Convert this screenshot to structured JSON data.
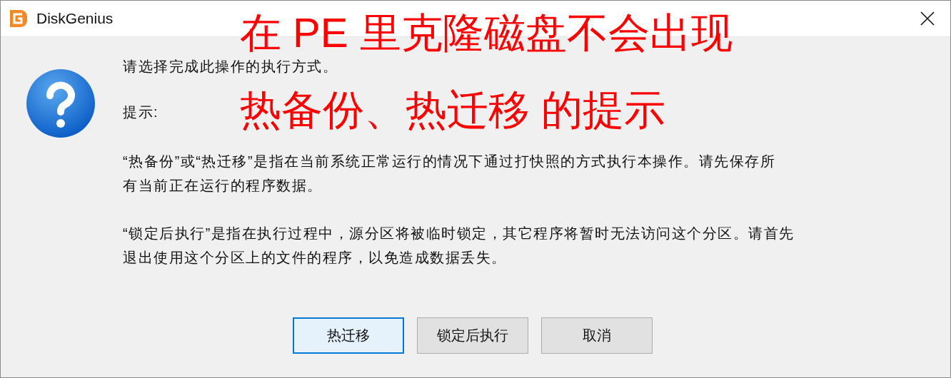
{
  "window": {
    "title": "DiskGenius"
  },
  "message": {
    "prompt": "请选择完成此操作的执行方式。",
    "hint_label": "提示:",
    "paragraphs": [
      {
        "lines": [
          "“热备份”或“热迁移”是指在当前系统正常运行的情况下通过打快照的方式执行本操作。请先保存所",
          "有当前正在运行的程序数据。"
        ]
      },
      {
        "lines": [
          "“锁定后执行”是指在执行过程中，源分区将被临时锁定，其它程序将暂时无法访问这个分区。请首先",
          "退出使用这个分区上的文件的程序，以免造成数据丢失。"
        ]
      }
    ]
  },
  "buttons": [
    {
      "label": "热迁移",
      "focused": true
    },
    {
      "label": "锁定后执行",
      "focused": false
    },
    {
      "label": "取消",
      "focused": false
    }
  ],
  "annotations": [
    "在 PE 里克隆磁盘不会出现",
    "热备份、热迁移 的提示"
  ]
}
